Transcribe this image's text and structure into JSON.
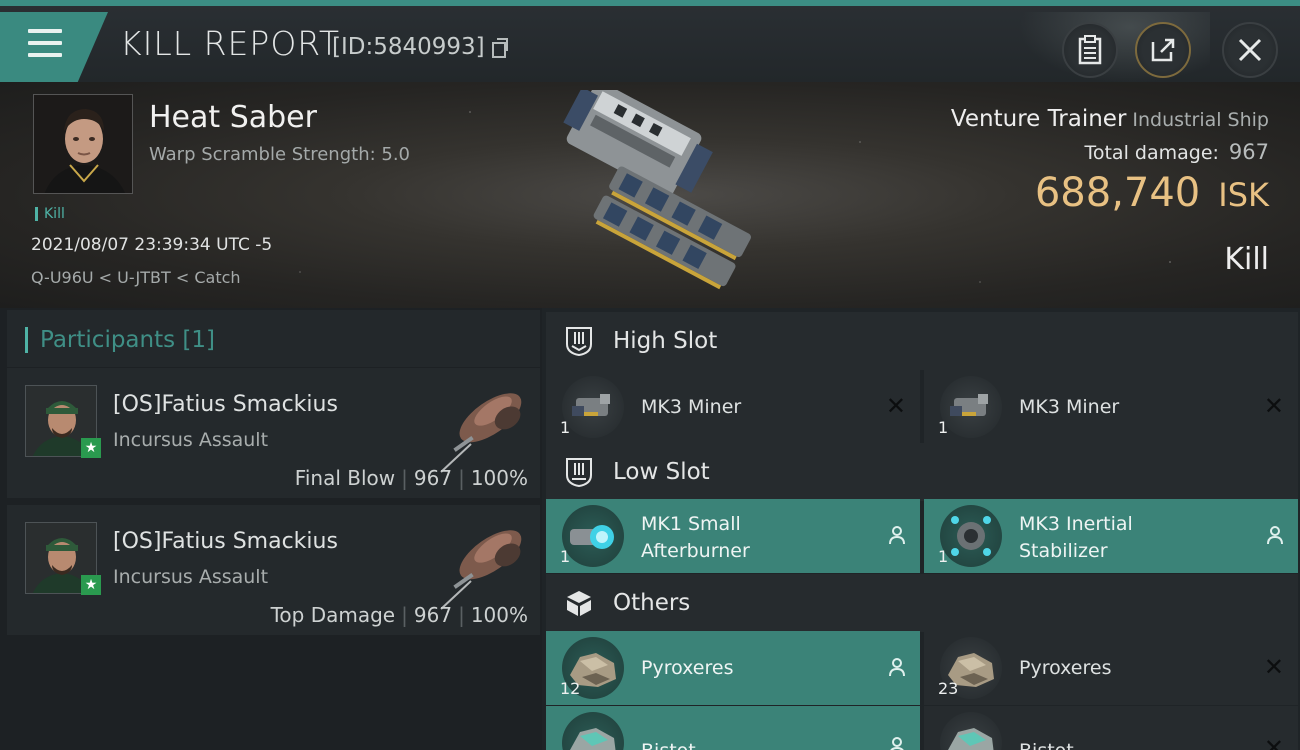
{
  "header": {
    "title": "KILL REPORT",
    "id_text": "[ID:5840993]"
  },
  "victim": {
    "name": "Heat Saber",
    "warp_scramble": "Warp Scramble Strength: 5.0",
    "kill_tag": "Kill",
    "datetime": "2021/08/07 23:39:34 UTC -5",
    "location": "Q-U96U < U-JTBT < Catch"
  },
  "ship": {
    "name": "Venture Trainer",
    "class": "Industrial Ship",
    "total_damage_label": "Total damage:",
    "total_damage": "967",
    "isk_value": "688,740",
    "isk_unit": "ISK",
    "result": "Kill"
  },
  "participants": {
    "header": "Participants [1]",
    "items": [
      {
        "name": "[OS]Fatius Smackius",
        "ship": "Incursus Assault",
        "role": "Final Blow",
        "damage": "967",
        "percent": "100%"
      },
      {
        "name": "[OS]Fatius Smackius",
        "ship": "Incursus Assault",
        "role": "Top Damage",
        "damage": "967",
        "percent": "100%"
      }
    ]
  },
  "slots": {
    "high": {
      "label": "High Slot",
      "items": [
        {
          "name_line1": "MK3 Miner",
          "name_line2": "",
          "qty": "1",
          "state": "destroyed"
        },
        {
          "name_line1": "MK3 Miner",
          "name_line2": "",
          "qty": "1",
          "state": "destroyed"
        }
      ]
    },
    "low": {
      "label": "Low Slot",
      "items": [
        {
          "name_line1": "MK1 Small",
          "name_line2": "Afterburner",
          "qty": "1",
          "state": "dropped"
        },
        {
          "name_line1": "MK3 Inertial",
          "name_line2": "Stabilizer",
          "qty": "1",
          "state": "dropped"
        }
      ]
    },
    "others": {
      "label": "Others",
      "items": [
        {
          "name_line1": "Pyroxeres",
          "qty": "12",
          "state": "dropped"
        },
        {
          "name_line1": "Pyroxeres",
          "qty": "23",
          "state": "destroyed"
        },
        {
          "name_line1": "Bistot",
          "qty": "",
          "state": "dropped"
        },
        {
          "name_line1": "Bistot",
          "qty": "",
          "state": "destroyed"
        }
      ]
    }
  },
  "icons": {
    "menu": "hamburger-icon",
    "copy": "copy-icon",
    "report": "clipboard-icon",
    "share": "share-icon",
    "close": "close-icon",
    "high_slot": "high-slot-icon",
    "low_slot": "low-slot-icon",
    "others": "cargo-box-icon",
    "destroyed": "x-mark-icon",
    "dropped": "person-icon"
  },
  "colors": {
    "accent": "#3b8378",
    "isk": "#e8c183",
    "header_accent": "#3c8e84"
  }
}
